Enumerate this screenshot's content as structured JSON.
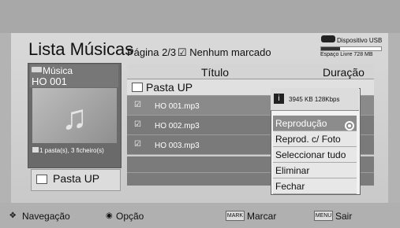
{
  "header": {
    "title": "Lista Músicas",
    "page": "Página 2/3",
    "marked_status": "☑ Nenhum marcado",
    "device": "Dispositivo USB",
    "free_space": "Espaço Livre 728 MB",
    "storage_used_fraction": 0.32
  },
  "left_panel": {
    "category": "Música",
    "selected": "HO 001",
    "counts": "1 pasta(s), 3 ficheiro(s)",
    "up_folder": "Pasta UP"
  },
  "table": {
    "columns": [
      "Título",
      "Duração"
    ],
    "up_row": "Pasta UP",
    "rows": [
      {
        "check": "☑",
        "title": "HO 001.mp3"
      },
      {
        "check": "☑",
        "title": "HO 002.mp3"
      },
      {
        "check": "☑",
        "title": "HO 003.mp3"
      }
    ]
  },
  "popup": {
    "info": "3945 KB 128Kbps",
    "items": [
      "Reprodução",
      "Reprod. c/ Foto",
      "Seleccionar tudo",
      "Eliminar",
      "Fechar"
    ]
  },
  "footer": {
    "nav": "Navegação",
    "option": "Opção",
    "mark_key": "MARK",
    "mark": "Marcar",
    "menu_key": "MENU",
    "exit": "Sair"
  },
  "colors": {
    "panel": "#d0d0d0",
    "selected_item": "#8c8c8c",
    "accent_white": "#ffffff"
  }
}
